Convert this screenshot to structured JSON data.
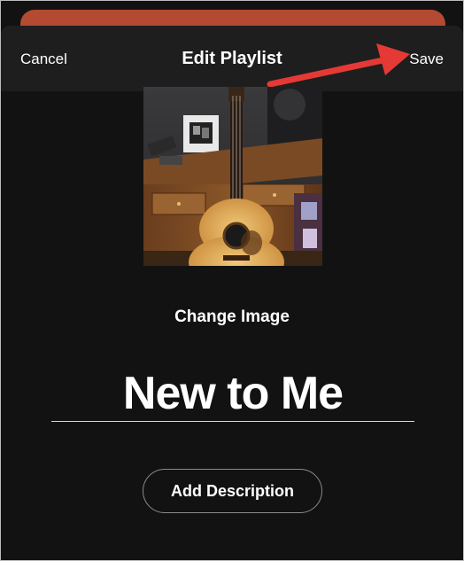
{
  "header": {
    "cancel_label": "Cancel",
    "title": "Edit Playlist",
    "save_label": "Save"
  },
  "cover": {
    "icon": "guitar-photo"
  },
  "change_image_label": "Change Image",
  "playlist_name": {
    "value": "New to Me"
  },
  "add_description_label": "Add Description",
  "colors": {
    "background": "#121212",
    "header_bar": "#1e1e1e",
    "peek_card": "#b34a31",
    "annotation_arrow": "#e53935",
    "text": "#ffffff"
  }
}
